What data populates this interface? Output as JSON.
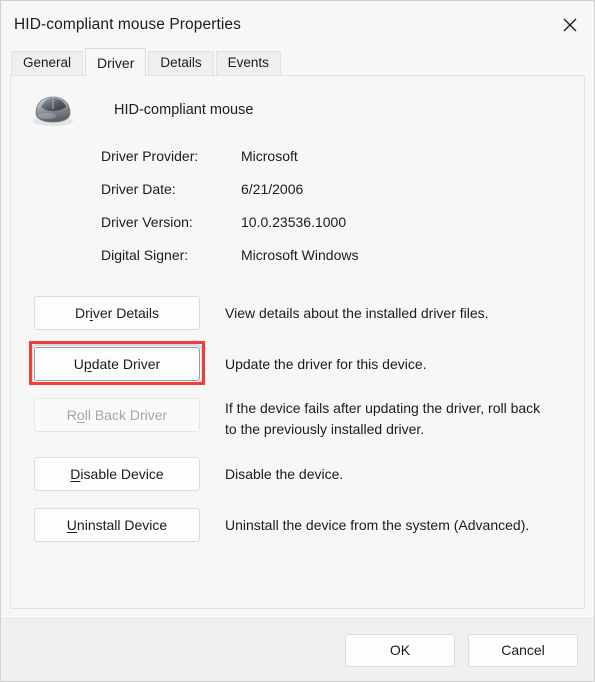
{
  "window": {
    "title": "HID-compliant mouse Properties",
    "close_icon": "close-icon"
  },
  "tabs": [
    {
      "label": "General",
      "active": false
    },
    {
      "label": "Driver",
      "active": true
    },
    {
      "label": "Details",
      "active": false
    },
    {
      "label": "Events",
      "active": false
    }
  ],
  "device": {
    "icon": "mouse-icon",
    "name": "HID-compliant mouse"
  },
  "driver_info": [
    {
      "label": "Driver Provider:",
      "value": "Microsoft"
    },
    {
      "label": "Driver Date:",
      "value": "6/21/2006"
    },
    {
      "label": "Driver Version:",
      "value": "10.0.23536.1000"
    },
    {
      "label": "Digital Signer:",
      "value": "Microsoft Windows"
    }
  ],
  "actions": [
    {
      "button": "Driver Details",
      "accel_before": "Dr",
      "accel_char": "i",
      "accel_after": "ver Details",
      "description": "View details about the installed driver files.",
      "disabled": false,
      "focused": false,
      "highlighted": false
    },
    {
      "button": "Update Driver",
      "accel_before": "U",
      "accel_char": "p",
      "accel_after": "date Driver",
      "description": "Update the driver for this device.",
      "disabled": false,
      "focused": true,
      "highlighted": true
    },
    {
      "button": "Roll Back Driver",
      "accel_before": "R",
      "accel_char": "o",
      "accel_after": "ll Back Driver",
      "description": "If the device fails after updating the driver, roll back to the previously installed driver.",
      "disabled": true,
      "focused": false,
      "highlighted": false
    },
    {
      "button": "Disable Device",
      "accel_before": "",
      "accel_char": "D",
      "accel_after": "isable Device",
      "description": "Disable the device.",
      "disabled": false,
      "focused": false,
      "highlighted": false
    },
    {
      "button": "Uninstall Device",
      "accel_before": "",
      "accel_char": "U",
      "accel_after": "ninstall Device",
      "description": "Uninstall the device from the system (Advanced).",
      "disabled": false,
      "focused": false,
      "highlighted": false
    }
  ],
  "footer": {
    "ok_label": "OK",
    "cancel_label": "Cancel"
  },
  "colors": {
    "highlight_red": "#ef3e33",
    "body_bg": "#f7f7f7",
    "footer_bg": "#f0f0f0",
    "text": "#1b1b1b",
    "disabled_text": "#a6a6a6"
  }
}
